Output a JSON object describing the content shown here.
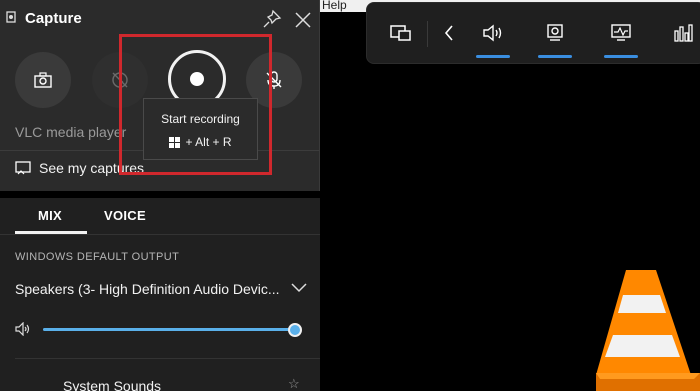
{
  "background_app": {
    "menu_visible": "Help"
  },
  "capture": {
    "title": "Capture",
    "app_name": "VLC media player",
    "see_captures": "See my captures",
    "record_button_state": "idle",
    "screenshot_icon": "camera-icon",
    "last30_icon": "history-off-icon",
    "mic_icon": "mic-off-icon"
  },
  "tooltip": {
    "title": "Start recording",
    "shortcut": "+ Alt + R",
    "key_icon": "windows-logo-icon"
  },
  "highlight_color": "#d0282d",
  "audio": {
    "tabs": [
      {
        "label": "MIX",
        "active": true
      },
      {
        "label": "VOICE",
        "active": false
      }
    ],
    "output_label": "WINDOWS DEFAULT OUTPUT",
    "device": "Speakers (3- High Definition Audio Devic...",
    "volume_percent": 100,
    "apps": [
      {
        "name": "System Sounds"
      }
    ]
  },
  "gamebar": {
    "buttons": [
      {
        "icon": "widget-menu-icon"
      },
      {
        "icon": "chevron-left-icon"
      },
      {
        "icon": "audio-icon",
        "active": true
      },
      {
        "icon": "capture-icon",
        "active": true
      },
      {
        "icon": "performance-icon",
        "active": true
      },
      {
        "icon": "resources-icon",
        "active": false
      }
    ]
  },
  "colors": {
    "accent": "#3a8ee0",
    "slider": "#5ab0ea"
  }
}
